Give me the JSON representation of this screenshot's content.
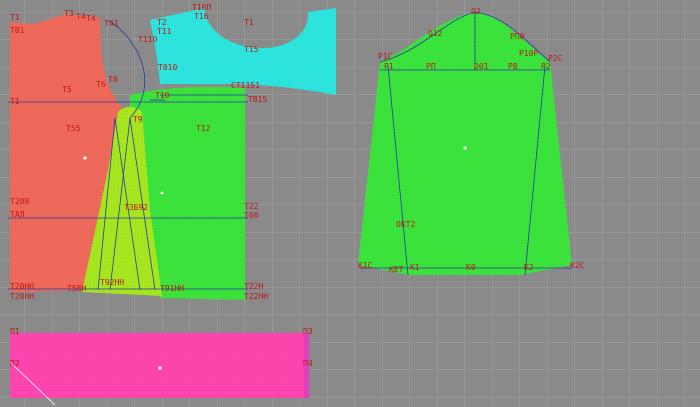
{
  "colors": {
    "background": "#8a8a8a",
    "grid": "#a3a3a3",
    "bodice_back": "#f06a5a",
    "bodice_front": "#3ce53c",
    "side_panel": "#a8e81e",
    "neck_facing": "#2ee6e0",
    "sleeve": "#3ce53c",
    "waistband": "#ff45b0",
    "construction_line": "#2a3aa8",
    "point_label": "#c01818"
  },
  "labels": {
    "back_bodice": {
      "t1": "T1",
      "t3": "T3",
      "t4": "T4",
      "t4b": "T4",
      "t41": "T41",
      "t01": "T01",
      "t8": "T8",
      "t6": "T6",
      "t5": "T5",
      "t55": "T55",
      "t208": "T208",
      "tal": "TAЛ",
      "t20nn": "T20HH",
      "t20hh": "T20HH",
      "t1side": "T1"
    },
    "front_bodice": {
      "t2": "T2",
      "t11": "T11",
      "t110": "T11O",
      "t010": "T010",
      "t9": "T9",
      "t12": "T12",
      "t22": "T22",
      "t00": "T00",
      "t22hh": "T22H",
      "t22nn": "T22HH",
      "t91hh": "T91HH"
    },
    "side_panel": {
      "t3": "T3",
      "t392": "T3Б92",
      "t92hh": "T92HH",
      "t58h": "T58H",
      "t10": "T10"
    },
    "neck_facing": {
      "t16p": "T16П",
      "t16": "T16",
      "t1": "T1",
      "t15": "T15",
      "t1151": "CT1151",
      "t815": "TB15"
    },
    "sleeve": {
      "o2": "O2",
      "p1c": "P1C",
      "p1": "P1",
      "o01": "O01",
      "pp": "PП",
      "p10p": "P10P",
      "p2c": "P2C",
      "p2": "P2",
      "p8": "PB",
      "pp0": "PП0",
      "okt2": "OKT2",
      "k1c": "K1C",
      "ket": "KET",
      "k1": "K1",
      "k0": "K0",
      "k2": "K2",
      "k2c": "K2C",
      "q12": "Q12"
    },
    "waistband": {
      "p1": "П1",
      "p3": "ПЗ",
      "p2": "П2",
      "p4": "П4"
    }
  }
}
